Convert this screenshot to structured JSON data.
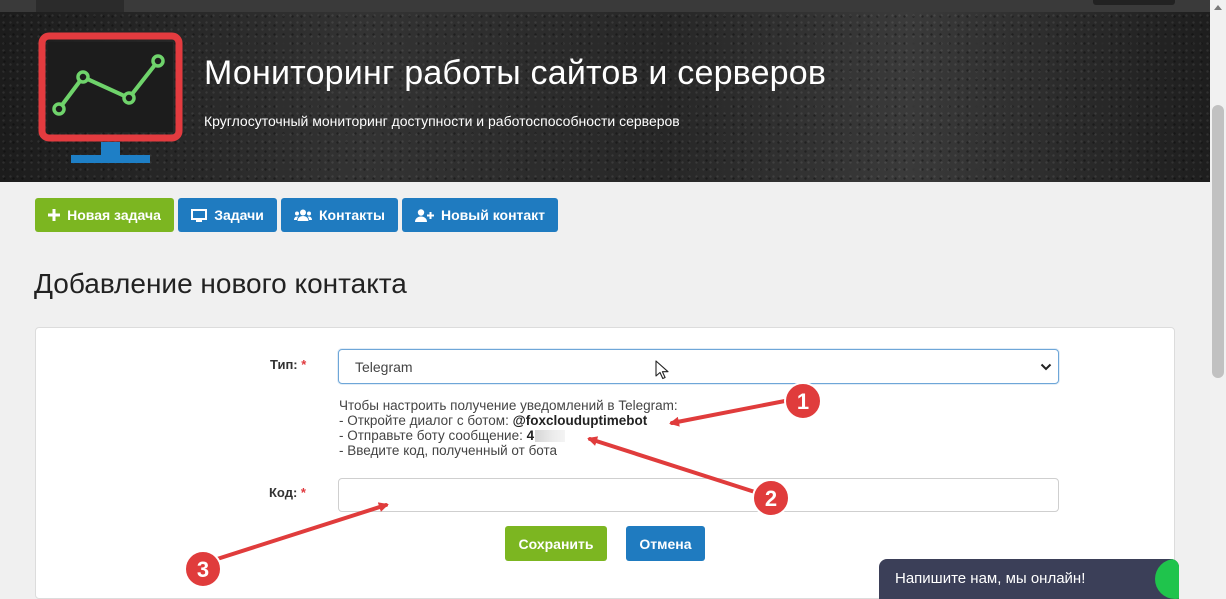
{
  "header": {
    "title": "Мониторинг работы сайтов и серверов",
    "subtitle": "Круглосуточный мониторинг доступности и работоспособности серверов"
  },
  "nav": {
    "new_task": "Новая задача",
    "tasks": "Задачи",
    "contacts": "Контакты",
    "new_contact": "Новый контакт"
  },
  "page": {
    "title": "Добавление нового контакта"
  },
  "form": {
    "type_label": "Тип:",
    "type_value": "Telegram",
    "required_mark": "*",
    "help_line1": "Чтобы настроить получение уведомлений в Telegram:",
    "help_line2_prefix": "- Откройте диалог с ботом: ",
    "bot_name": "@foxclouduptimebot",
    "help_line3_prefix": "- Отправьте боту сообщение: ",
    "message_code_visible": "4",
    "help_line4": "- Введите код, полученный от бота",
    "code_label": "Код:",
    "code_value": "",
    "save_label": "Сохранить",
    "cancel_label": "Отмена"
  },
  "annotations": {
    "marker_1": "1",
    "marker_2": "2",
    "marker_3": "3"
  },
  "chat": {
    "label": "Напишите нам, мы онлайн!"
  },
  "colors": {
    "green": "#7cb621",
    "blue": "#1f7bc0",
    "marker_red": "#e03c3c",
    "chat_bg": "#3b3f58"
  },
  "icons": {
    "new_task": "plus-icon",
    "tasks": "monitor-icon",
    "contacts": "users-icon",
    "new_contact": "user-plus-icon"
  }
}
